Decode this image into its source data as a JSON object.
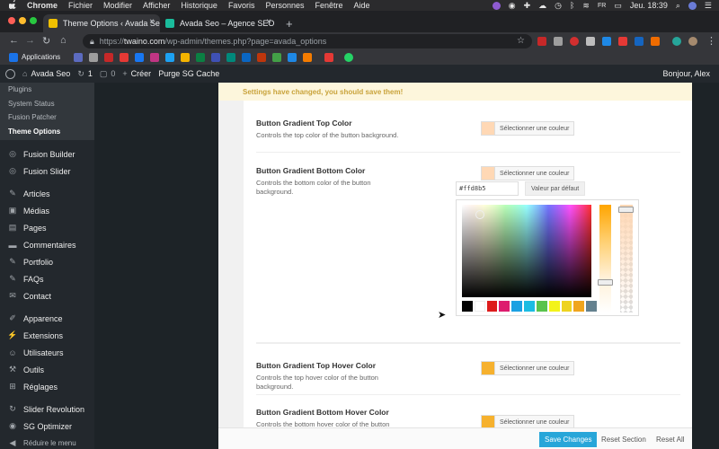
{
  "mac_menu": {
    "app": "Chrome",
    "items": [
      "Fichier",
      "Modifier",
      "Afficher",
      "Historique",
      "Favoris",
      "Personnes",
      "Fenêtre",
      "Aide"
    ],
    "flag": "FR",
    "clock": "Jeu. 18:39"
  },
  "tabs": [
    {
      "title": "Theme Options ‹ Avada Seo —",
      "active": true,
      "favicon_color": "#f0c000"
    },
    {
      "title": "Avada Seo – Agence SEO",
      "active": false,
      "favicon_color": "#1abc9c"
    }
  ],
  "address": {
    "scheme": "https://",
    "host": "twaino.com",
    "path": "/wp-admin/themes.php?page=avada_options"
  },
  "bookmarks": {
    "apps_label": "Applications"
  },
  "admin_bar": {
    "site": "Avada Seo",
    "updates": "1",
    "comments": "0",
    "new": "Créer",
    "purge": "Purge SG Cache",
    "greeting": "Bonjour, Alex"
  },
  "sidebar": {
    "submenu": [
      "Plugins",
      "System Status",
      "Fusion Patcher",
      "Theme Options"
    ],
    "current_sub": "Theme Options",
    "items": [
      {
        "label": "Fusion Builder",
        "icon": "fusion-icon"
      },
      {
        "label": "Fusion Slider",
        "icon": "fusion-icon"
      },
      {
        "label": "Articles",
        "icon": "pin-icon"
      },
      {
        "label": "Médias",
        "icon": "media-icon"
      },
      {
        "label": "Pages",
        "icon": "page-icon"
      },
      {
        "label": "Commentaires",
        "icon": "comment-icon"
      },
      {
        "label": "Portfolio",
        "icon": "pin-icon"
      },
      {
        "label": "FAQs",
        "icon": "pin-icon"
      },
      {
        "label": "Contact",
        "icon": "mail-icon"
      },
      {
        "label": "Apparence",
        "icon": "brush-icon"
      },
      {
        "label": "Extensions",
        "icon": "plugin-icon"
      },
      {
        "label": "Utilisateurs",
        "icon": "user-icon"
      },
      {
        "label": "Outils",
        "icon": "wrench-icon"
      },
      {
        "label": "Réglages",
        "icon": "settings-icon"
      },
      {
        "label": "Slider Revolution",
        "icon": "refresh-icon"
      },
      {
        "label": "SG Optimizer",
        "icon": "sg-icon"
      },
      {
        "label": "Réduire le menu",
        "icon": "collapse-icon"
      }
    ]
  },
  "notice": "Settings have changed, you should save them!",
  "options": [
    {
      "title": "Button Gradient Top Color",
      "desc": "Controls the top color of the button background.",
      "color": "#ffd8b5",
      "button": "Sélectionner une couleur"
    },
    {
      "title": "Button Gradient Bottom Color",
      "desc": "Controls the bottom color of the button background.",
      "color": "#ffd8b5",
      "button": "Sélectionner une couleur"
    },
    {
      "title": "Button Gradient Top Hover Color",
      "desc": "Controls the top hover color of the button background.",
      "color": "#f6b12e",
      "button": "Sélectionner une couleur"
    },
    {
      "title": "Button Gradient Bottom Hover Color",
      "desc": "Controls the bottom hover color of the button background.",
      "color": "#f6b12e",
      "button": "Sélectionner une couleur"
    }
  ],
  "picker": {
    "hex": "#ffd8b5",
    "default_label": "Valeur par défaut",
    "palette": [
      "#000000",
      "#ffffff",
      "#dd1c1c",
      "#dd1c6e",
      "#1ba1e2",
      "#1bbce2",
      "#59c34d",
      "#f3f31a",
      "#eed321",
      "#f0a51e",
      "#64818f"
    ]
  },
  "footer": {
    "save": "Save Changes",
    "reset_section": "Reset Section",
    "reset_all": "Reset All"
  },
  "colors": {
    "accent": "#27a6d9",
    "wp_dark": "#23282d"
  }
}
